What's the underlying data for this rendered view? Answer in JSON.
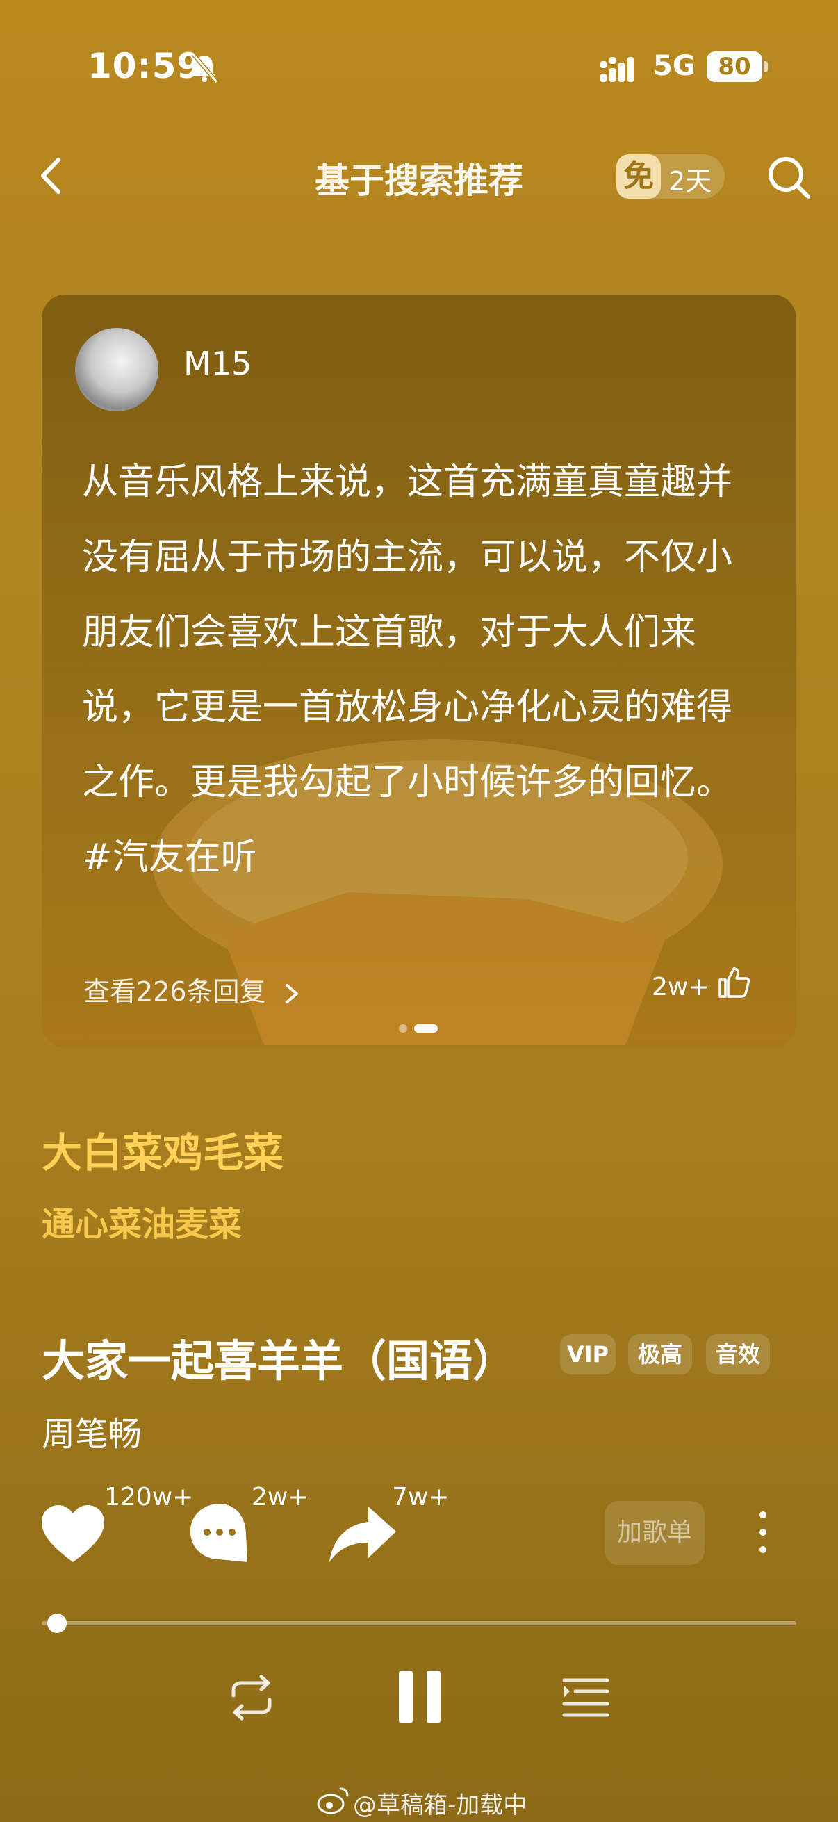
{
  "status_bar": {
    "time": "10:59",
    "network": "5G",
    "battery": "80"
  },
  "header": {
    "title": "基于搜索推荐",
    "free_badge": "免",
    "free_days": "2天"
  },
  "comment_card": {
    "username": "M15",
    "text": "从音乐风格上来说，这首充满童真童趣并没有屈从于市场的主流，可以说，不仅小朋友们会喜欢上这首歌，对于大人们来说，它更是一首放松身心净化心灵的难得之作。更是我勾起了小时候许多的回忆。#汽友在听",
    "replies_label": "查看226条回复",
    "likes": "2w+"
  },
  "lyrics": {
    "current": "大白菜鸡毛菜",
    "next": "通心菜油麦菜"
  },
  "song": {
    "title": "大家一起喜羊羊（国语）",
    "tags": [
      "VIP",
      "极高",
      "音效"
    ],
    "artist": "周笔畅"
  },
  "actions": {
    "like_count": "120w+",
    "comment_count": "2w+",
    "share_count": "7w+",
    "add_to_playlist": "加歌单"
  },
  "player": {
    "progress": 0.02
  },
  "watermark": "@草稿箱-加载中",
  "colors": {
    "background": "#b08420",
    "lyric_highlight": "#ffd257",
    "lyric_next": "#f6c94d"
  }
}
